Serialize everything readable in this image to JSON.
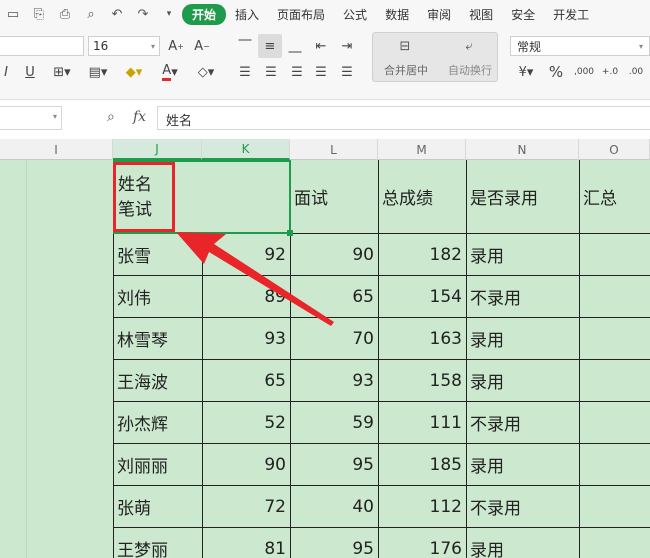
{
  "menubar": {
    "tabs": [
      "开始",
      "插入",
      "页面布局",
      "公式",
      "数据",
      "审阅",
      "视图",
      "安全",
      "开发工"
    ]
  },
  "ribbon": {
    "font_size": "16",
    "number_format": "常规",
    "merge_label": "合并居中",
    "wrap_label": "自动换行",
    "percent_symbol": "%"
  },
  "formula_bar": {
    "fx_label": "fx",
    "content": "姓名"
  },
  "columns": [
    "I",
    "J",
    "K",
    "L",
    "M",
    "N",
    "O"
  ],
  "sheet": {
    "header": {
      "j_line1": "姓名",
      "j_line2": "笔试",
      "l": "面试",
      "m": "总成绩",
      "n": "是否录用",
      "o": "汇总"
    },
    "rows": [
      {
        "name": "张雪",
        "written": "92",
        "interview": "90",
        "total": "182",
        "hired": "录用"
      },
      {
        "name": "刘伟",
        "written": "89",
        "interview": "65",
        "total": "154",
        "hired": "不录用"
      },
      {
        "name": "林雪琴",
        "written": "93",
        "interview": "70",
        "total": "163",
        "hired": "录用"
      },
      {
        "name": "王海波",
        "written": "65",
        "interview": "93",
        "total": "158",
        "hired": "录用"
      },
      {
        "name": "孙杰辉",
        "written": "52",
        "interview": "59",
        "total": "111",
        "hired": "不录用"
      },
      {
        "name": "刘丽丽",
        "written": "90",
        "interview": "95",
        "total": "185",
        "hired": "录用"
      },
      {
        "name": "张萌",
        "written": "72",
        "interview": "40",
        "total": "112",
        "hired": "不录用"
      },
      {
        "name": "王梦丽",
        "written": "81",
        "interview": "95",
        "total": "176",
        "hired": "录用"
      }
    ]
  },
  "colors": {
    "accent": "#1f9c4b",
    "grid_bg": "#cce8cf",
    "highlight": "#e8262a"
  }
}
